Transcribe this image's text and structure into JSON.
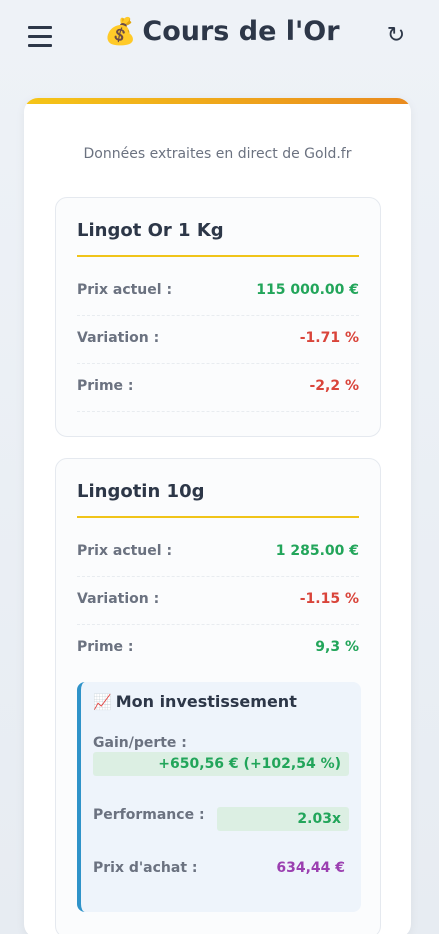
{
  "header": {
    "title": "Cours de l'Or",
    "title_icon": "money-bag-icon",
    "menu_icon": "hamburger-menu-icon",
    "refresh_icon": "refresh-icon"
  },
  "source_text": "Données extraites en direct de Gold.fr",
  "products": [
    {
      "name": "Lingot Or 1 Kg",
      "rows": [
        {
          "label": "Prix actuel :",
          "value": "115 000.00 €",
          "color": "#22a55a"
        },
        {
          "label": "Variation :",
          "value": "-1.71 %",
          "color": "#d9443a"
        },
        {
          "label": "Prime :",
          "value": "-2,2 %",
          "color": "#d9443a"
        }
      ]
    },
    {
      "name": "Lingotin 10g",
      "rows": [
        {
          "label": "Prix actuel :",
          "value": "1 285.00 €",
          "color": "#22a55a"
        },
        {
          "label": "Variation :",
          "value": "-1.15 %",
          "color": "#d9443a"
        },
        {
          "label": "Prime :",
          "value": "9,3 %",
          "color": "#22a55a"
        }
      ],
      "investment": {
        "title": "Mon investissement",
        "title_icon": "chart-increasing-icon",
        "gain_label": "Gain/perte :",
        "gain_value": "+650,56 € (+102,54 %)",
        "performance_label": "Performance :",
        "performance_value": "2.03x",
        "purchase_label": "Prix d'achat :",
        "purchase_value": "634,44 €"
      }
    }
  ],
  "colors": {
    "accent_gold": "#f0c419",
    "positive": "#22a55a",
    "negative": "#d9443a",
    "purchase": "#9b3fb0",
    "invest_border": "#2f93c9"
  }
}
